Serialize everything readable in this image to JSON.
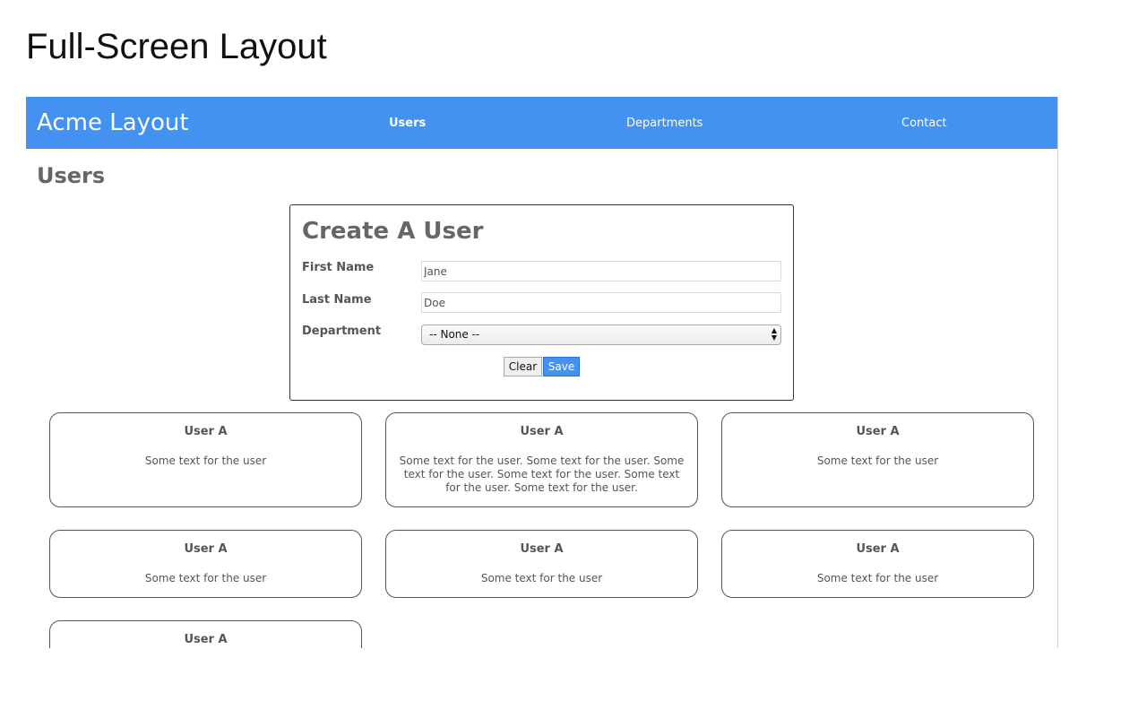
{
  "page": {
    "heading": "Full-Screen Layout"
  },
  "navbar": {
    "brand": "Acme Layout",
    "links": [
      {
        "label": "Users",
        "active": true
      },
      {
        "label": "Departments",
        "active": false
      },
      {
        "label": "Contact",
        "active": false
      }
    ],
    "color": "#4392f1"
  },
  "main": {
    "section_title": "Users"
  },
  "form": {
    "title": "Create A User",
    "first_name": {
      "label": "First Name",
      "value": "Jane"
    },
    "last_name": {
      "label": "Last Name",
      "value": "Doe"
    },
    "department": {
      "label": "Department",
      "selected": "-- None --"
    },
    "clear_label": "Clear",
    "save_label": "Save"
  },
  "users": [
    {
      "name": "User A",
      "text": "Some text for the user"
    },
    {
      "name": "User A",
      "text": "Some text for the user. Some text for the user. Some text for the user. Some text for the user. Some text for the user. Some text for the user."
    },
    {
      "name": "User A",
      "text": "Some text for the user"
    },
    {
      "name": "User A",
      "text": "Some text for the user"
    },
    {
      "name": "User A",
      "text": "Some text for the user"
    },
    {
      "name": "User A",
      "text": "Some text for the user"
    },
    {
      "name": "User A",
      "text": ""
    }
  ]
}
